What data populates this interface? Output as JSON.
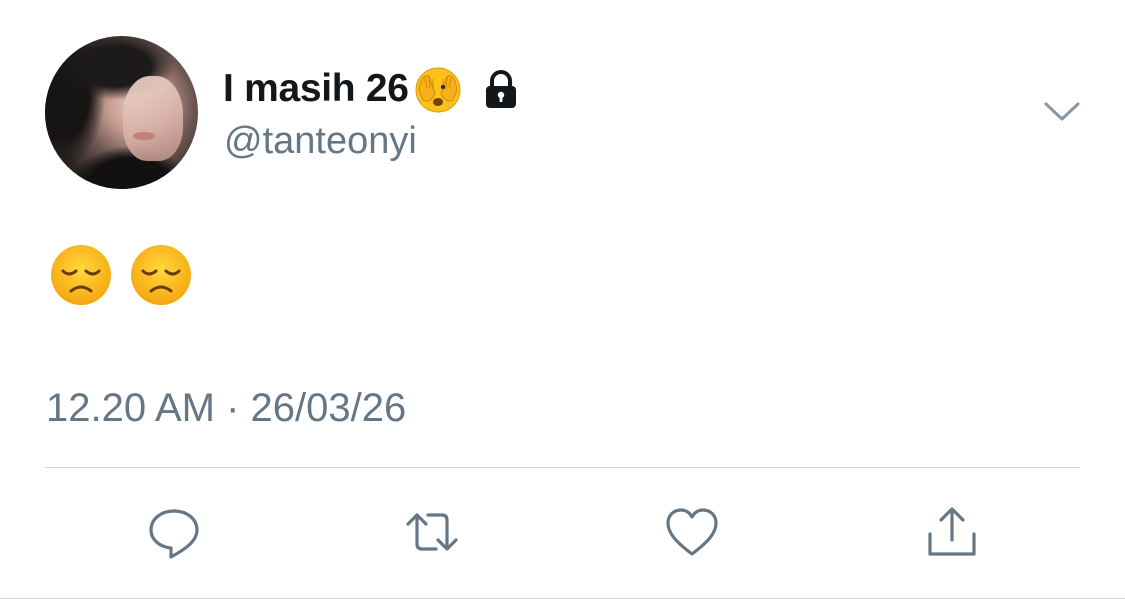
{
  "user": {
    "display_name": "I masih 26",
    "handle": "@tanteonyi",
    "name_emoji": "face-with-hands-over-eyes-icon",
    "protected_icon": "lock-icon",
    "avatar": "profile-avatar"
  },
  "tweet": {
    "body_emojis": [
      "disappointed-face-icon",
      "disappointed-face-icon"
    ],
    "timestamp": "12.20 AM · 26/03/26"
  },
  "actions": [
    {
      "name": "reply",
      "icon": "comment-icon"
    },
    {
      "name": "retweet",
      "icon": "retweet-icon"
    },
    {
      "name": "like",
      "icon": "heart-icon"
    },
    {
      "name": "share",
      "icon": "share-icon"
    }
  ],
  "menu": {
    "icon": "chevron-down-icon"
  },
  "colors": {
    "text_primary": "#14171a",
    "text_secondary": "#657786",
    "icon_gray": "#657786",
    "divider": "#cfd9de"
  }
}
